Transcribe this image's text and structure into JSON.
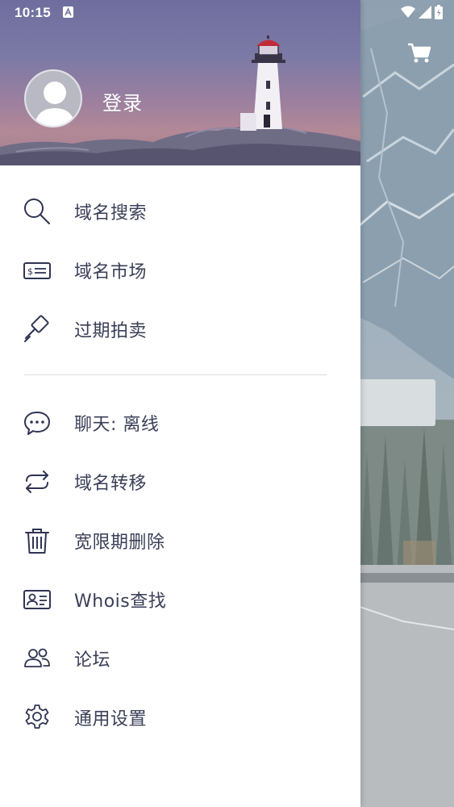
{
  "status_bar": {
    "time": "10:15"
  },
  "header": {
    "login_label": "登录"
  },
  "menu": {
    "group1": [
      {
        "label": "域名搜索",
        "icon": "search-icon"
      },
      {
        "label": "域名市场",
        "icon": "ticket-icon"
      },
      {
        "label": "过期拍卖",
        "icon": "gavel-icon"
      }
    ],
    "group2": [
      {
        "label": "聊天: 离线",
        "icon": "chat-icon"
      },
      {
        "label": "域名转移",
        "icon": "transfer-icon"
      },
      {
        "label": "宽限期删除",
        "icon": "trash-icon"
      },
      {
        "label": "Whois查找",
        "icon": "id-card-icon"
      },
      {
        "label": "论坛",
        "icon": "users-icon"
      },
      {
        "label": "通用设置",
        "icon": "gear-icon"
      }
    ]
  },
  "colors": {
    "menu_text": "#3a3f58",
    "icon_stroke": "#2f3452",
    "divider": "#d9dbe2"
  }
}
